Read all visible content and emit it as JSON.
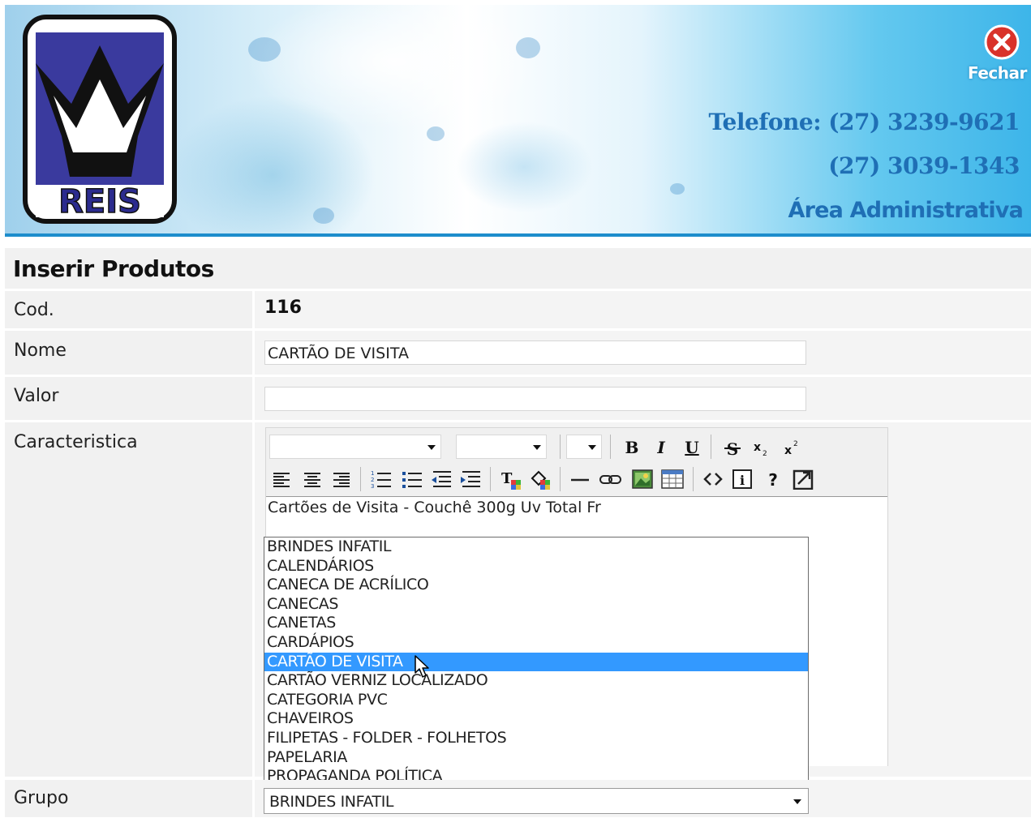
{
  "header": {
    "logo_text": "REIS",
    "close_label": "Fechar",
    "phone_1": "Telefone: (27) 3239-9621",
    "phone_2": "(27) 3039-1343",
    "admin_area": "Área Administrativa"
  },
  "page_title": "Inserir Produtos",
  "form": {
    "cod_label": "Cod.",
    "cod_value": "116",
    "nome_label": "Nome",
    "nome_value": "CARTÃO DE VISITA",
    "valor_label": "Valor",
    "valor_value": "",
    "caracteristica_label": "Caracteristica",
    "caracteristica_value": "Cartões de Visita - Couchê 300g Uv Total Fr",
    "grupo_label": "Grupo",
    "grupo_value": "BRINDES INFATIL"
  },
  "toolbar": {
    "bold": "B",
    "italic": "I",
    "underline": "U",
    "help": "?",
    "info": "i"
  },
  "grupo_options": [
    "BRINDES INFATIL",
    "CALENDÁRIOS",
    "CANECA DE ACRÍLICO",
    "CANECAS",
    "CANETAS",
    "CARDÁPIOS",
    "CARTÃO DE VISITA",
    "CARTÃO VERNIZ LOCALIZADO",
    "CATEGORIA PVC",
    "CHAVEIROS",
    "FILIPETAS - FOLDER - FOLHETOS",
    "PAPELARIA",
    "PROPAGANDA POLÍTICA"
  ],
  "highlighted_option": "CARTÃO DE VISITA",
  "colors": {
    "header_blue": "#1f6fb5",
    "highlight": "#3399ff",
    "close_red": "#d9322a"
  }
}
